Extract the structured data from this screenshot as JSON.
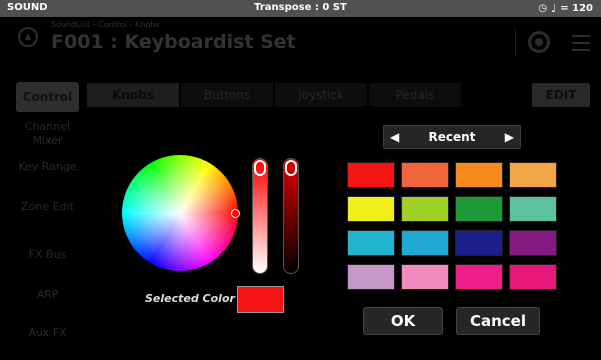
{
  "status_bar": {
    "left": "SOUND",
    "center": "Transpose : 0 ST",
    "tempo_icon": "♩",
    "tempo": "= 120"
  },
  "header": {
    "breadcrumb": "SoundList - Control - Knobs",
    "performance_name": "F001 : Keyboardist Set"
  },
  "sidebar": {
    "items": [
      {
        "label": "Control"
      },
      {
        "label": "Channel Mixer"
      },
      {
        "label": "Key Range"
      },
      {
        "label": "Zone Edit"
      },
      {
        "label": "FX Bus"
      },
      {
        "label": "ARP"
      },
      {
        "label": "Aux FX"
      }
    ]
  },
  "tabs": [
    {
      "label": "Knobs"
    },
    {
      "label": "Buttons"
    },
    {
      "label": "Joystick"
    },
    {
      "label": "Pedals"
    }
  ],
  "edit_label": "EDIT",
  "color_picker": {
    "recent_label": "Recent",
    "prev_arrow": "◀",
    "next_arrow": "▶",
    "selected_color_label": "Selected Color",
    "selected_color": "#f41414",
    "swatches": [
      "#f41414",
      "#f2643c",
      "#f78a1e",
      "#f2a548",
      "#f0ef1a",
      "#9ed026",
      "#1e9938",
      "#5fc29f",
      "#22b5cf",
      "#20a9d2",
      "#1c1e8c",
      "#851a82",
      "#c497c8",
      "#f28bbf",
      "#ec1f8b",
      "#e8187a"
    ],
    "ok_label": "OK",
    "cancel_label": "Cancel"
  }
}
